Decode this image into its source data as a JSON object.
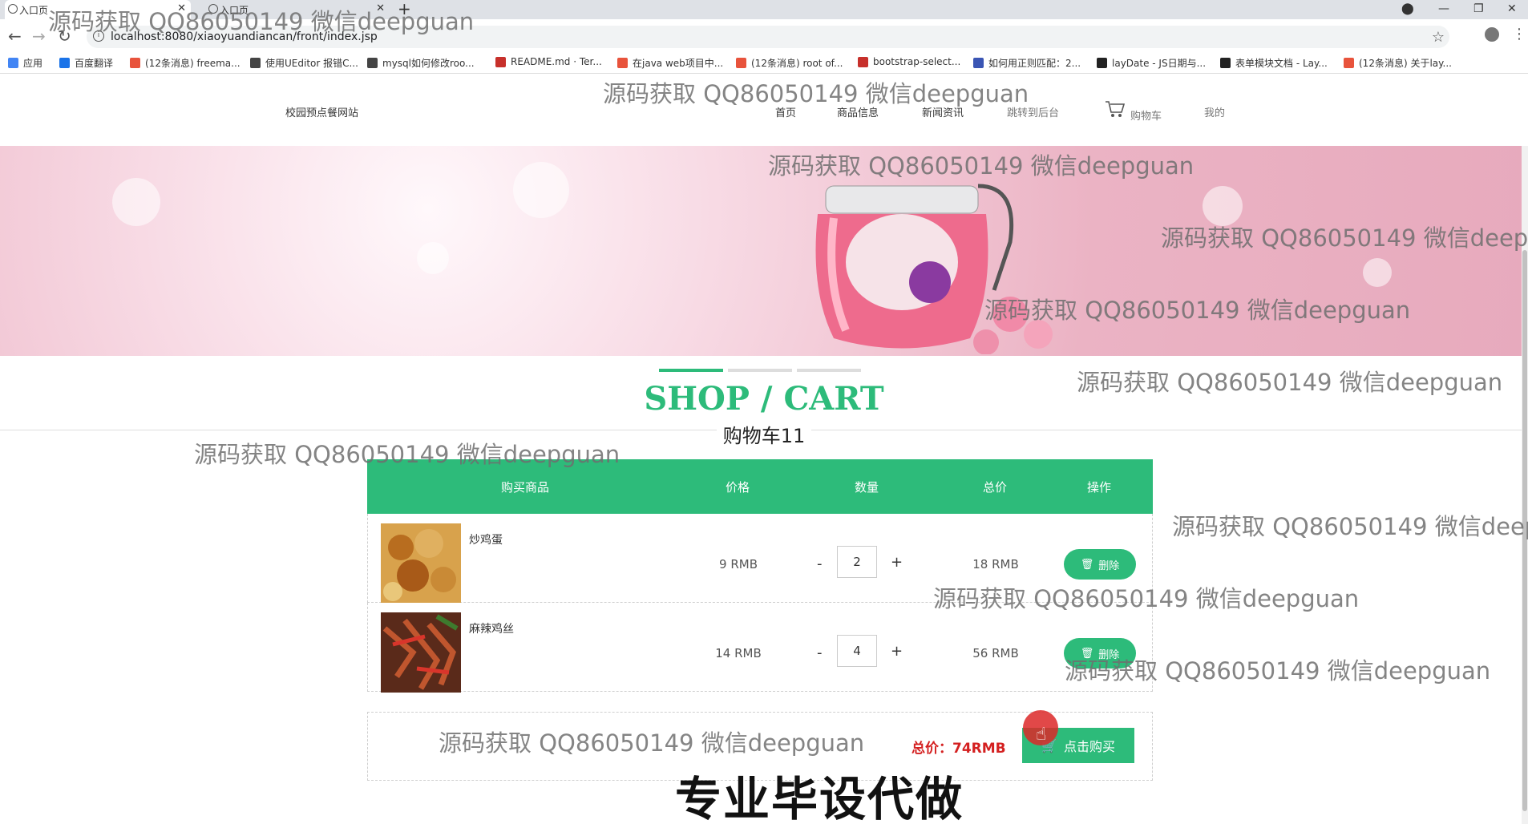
{
  "browser": {
    "tabs": [
      {
        "title": "入口页"
      },
      {
        "title": "入口页"
      }
    ],
    "url": "localhost:8080/xiaoyuandiancan/front/index.jsp",
    "bookmarks": [
      {
        "label": "应用",
        "color": "#4285f4"
      },
      {
        "label": "百度翻译",
        "color": "#1a73e8"
      },
      {
        "label": "(12条消息) freema...",
        "color": "#e8533c"
      },
      {
        "label": "使用UEditor 报错C...",
        "color": "#444444"
      },
      {
        "label": "mysql如何修改roo...",
        "color": "#444444"
      },
      {
        "label": "README.md · Ter...",
        "color": "#c7302b"
      },
      {
        "label": "在java web项目中...",
        "color": "#e8533c"
      },
      {
        "label": "(12条消息) root of...",
        "color": "#e8533c"
      },
      {
        "label": "bootstrap-select...",
        "color": "#c7302b"
      },
      {
        "label": "如何用正则匹配：2...",
        "color": "#3a55b4"
      },
      {
        "label": "layDate - JS日期与...",
        "color": "#222222"
      },
      {
        "label": "表单模块文档 - Lay...",
        "color": "#222222"
      },
      {
        "label": "(12条消息) 关于lay...",
        "color": "#e8533c"
      }
    ]
  },
  "site": {
    "title": "校园预点餐网站",
    "nav": [
      "首页",
      "商品信息",
      "新闻资讯",
      "跳转到后台",
      "购物车",
      "我的"
    ]
  },
  "cart": {
    "heading": "SHOP / CART",
    "subheading": "购物车11",
    "columns": [
      "购买商品",
      "价格",
      "数量",
      "总价",
      "操作"
    ],
    "items": [
      {
        "name": "炒鸡蛋",
        "price": "9 RMB",
        "qty": "2",
        "total": "18 RMB",
        "delete_label": "删除"
      },
      {
        "name": "麻辣鸡丝",
        "price": "14 RMB",
        "qty": "4",
        "total": "56 RMB",
        "delete_label": "删除"
      }
    ],
    "minus": "-",
    "plus": "+",
    "grand_total": "总价：74RMB",
    "buy_label": "点击购买"
  },
  "watermark": "源码获取 QQ86050149 微信deepguan",
  "promo_text": "专业毕设代做",
  "colors": {
    "accent": "#2dbb7a",
    "total_red": "#d42020"
  }
}
